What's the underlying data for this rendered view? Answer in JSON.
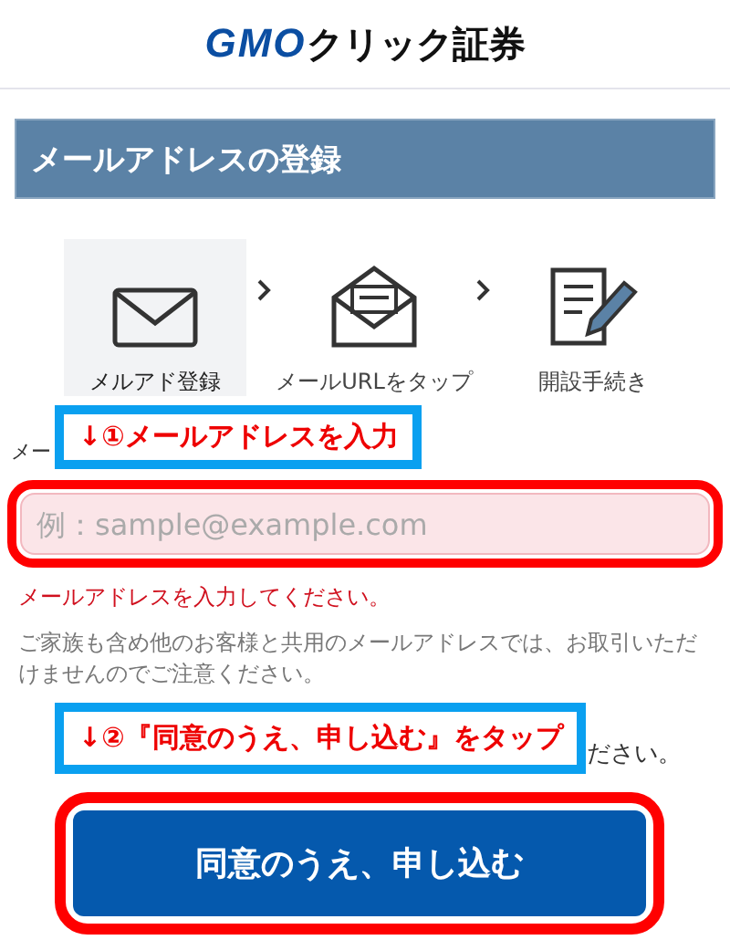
{
  "logo": {
    "mark": "GMO",
    "name": "クリック証券"
  },
  "page_title": "メールアドレスの登録",
  "steps": [
    {
      "label": "メルアド登録",
      "kind": "envelope",
      "selected": true
    },
    {
      "label": "メールURLをタップ",
      "kind": "letter",
      "selected": false
    },
    {
      "label": "開設手続き",
      "kind": "form",
      "selected": false
    }
  ],
  "field_label": "メー",
  "email_field": {
    "placeholder": "例：sample@example.com",
    "error": true,
    "highlighted": true
  },
  "error_message": "メールアドレスを入力してください。",
  "note": "ご家族も含め他のお客様と共用のメールアドレスでは、お取引いただけませんのでご注意ください。",
  "partial_text": "ださい。",
  "callouts": [
    "↓①メールアドレスを入力",
    "↓②『同意のうえ、申し込む』をタップ"
  ],
  "submit_button": {
    "label": "同意のうえ、申し込む",
    "highlighted": true
  }
}
